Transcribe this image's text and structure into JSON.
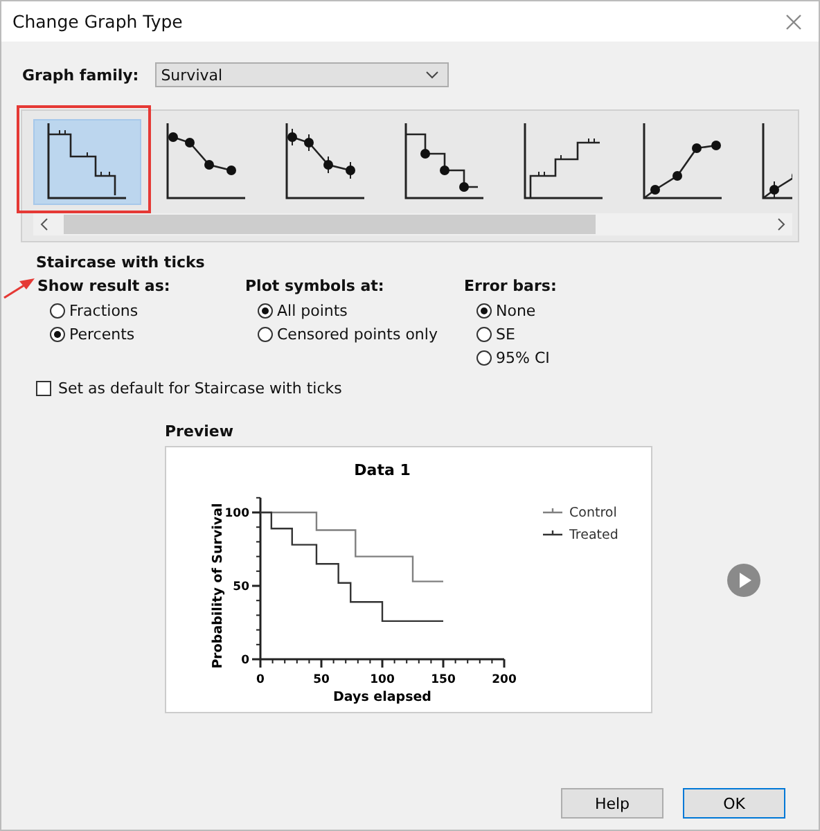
{
  "window": {
    "title": "Change Graph Type"
  },
  "graph_family": {
    "label": "Graph family:",
    "value": "Survival"
  },
  "gallery": {
    "items": [
      {
        "kind": "staircase_ticks",
        "selected": true
      },
      {
        "kind": "points_line",
        "selected": false
      },
      {
        "kind": "points_errorbars",
        "selected": false
      },
      {
        "kind": "staircase_points",
        "selected": false
      },
      {
        "kind": "staircase_up_ticks",
        "selected": false
      },
      {
        "kind": "points_line_up",
        "selected": false
      },
      {
        "kind": "points_errorbars_up",
        "selected": false
      }
    ]
  },
  "selected_type_name": "Staircase with ticks",
  "groups": [
    {
      "title": "Show result as:",
      "options": [
        {
          "label": "Fractions",
          "selected": false
        },
        {
          "label": "Percents",
          "selected": true
        }
      ]
    },
    {
      "title": "Plot symbols at:",
      "options": [
        {
          "label": "All points",
          "selected": true
        },
        {
          "label": "Censored points only",
          "selected": false
        }
      ]
    },
    {
      "title": "Error bars:",
      "options": [
        {
          "label": "None",
          "selected": true
        },
        {
          "label": "SE",
          "selected": false
        },
        {
          "label": "95% CI",
          "selected": false
        }
      ]
    }
  ],
  "default_checkbox": {
    "label": "Set as default for Staircase with ticks",
    "checked": false
  },
  "preview": {
    "title": "Preview",
    "chart_data": {
      "type": "line",
      "title": "Data 1",
      "xlabel": "Days elapsed",
      "ylabel": "Probability of Survival",
      "x": [
        0,
        9,
        9,
        26,
        26,
        46,
        46,
        64,
        64,
        74,
        74,
        78,
        78,
        100,
        100,
        125,
        125,
        150
      ],
      "series": [
        {
          "name": "Control",
          "color": "#808080",
          "values": [
            100,
            100,
            100,
            100,
            100,
            100,
            88,
            88,
            88,
            88,
            88,
            88,
            70,
            70,
            70,
            70,
            53,
            53
          ]
        },
        {
          "name": "Treated",
          "color": "#333333",
          "values": [
            100,
            100,
            89,
            89,
            78,
            78,
            65,
            65,
            52,
            52,
            39,
            39,
            39,
            39,
            26,
            26,
            26,
            26
          ]
        }
      ],
      "legend": "upper right",
      "xlim": [
        0,
        200
      ],
      "ylim": [
        0,
        110
      ],
      "xticks": [
        0,
        50,
        100,
        150,
        200
      ],
      "yticks": [
        0,
        50,
        100
      ]
    }
  },
  "buttons": [
    "Help",
    "OK"
  ]
}
